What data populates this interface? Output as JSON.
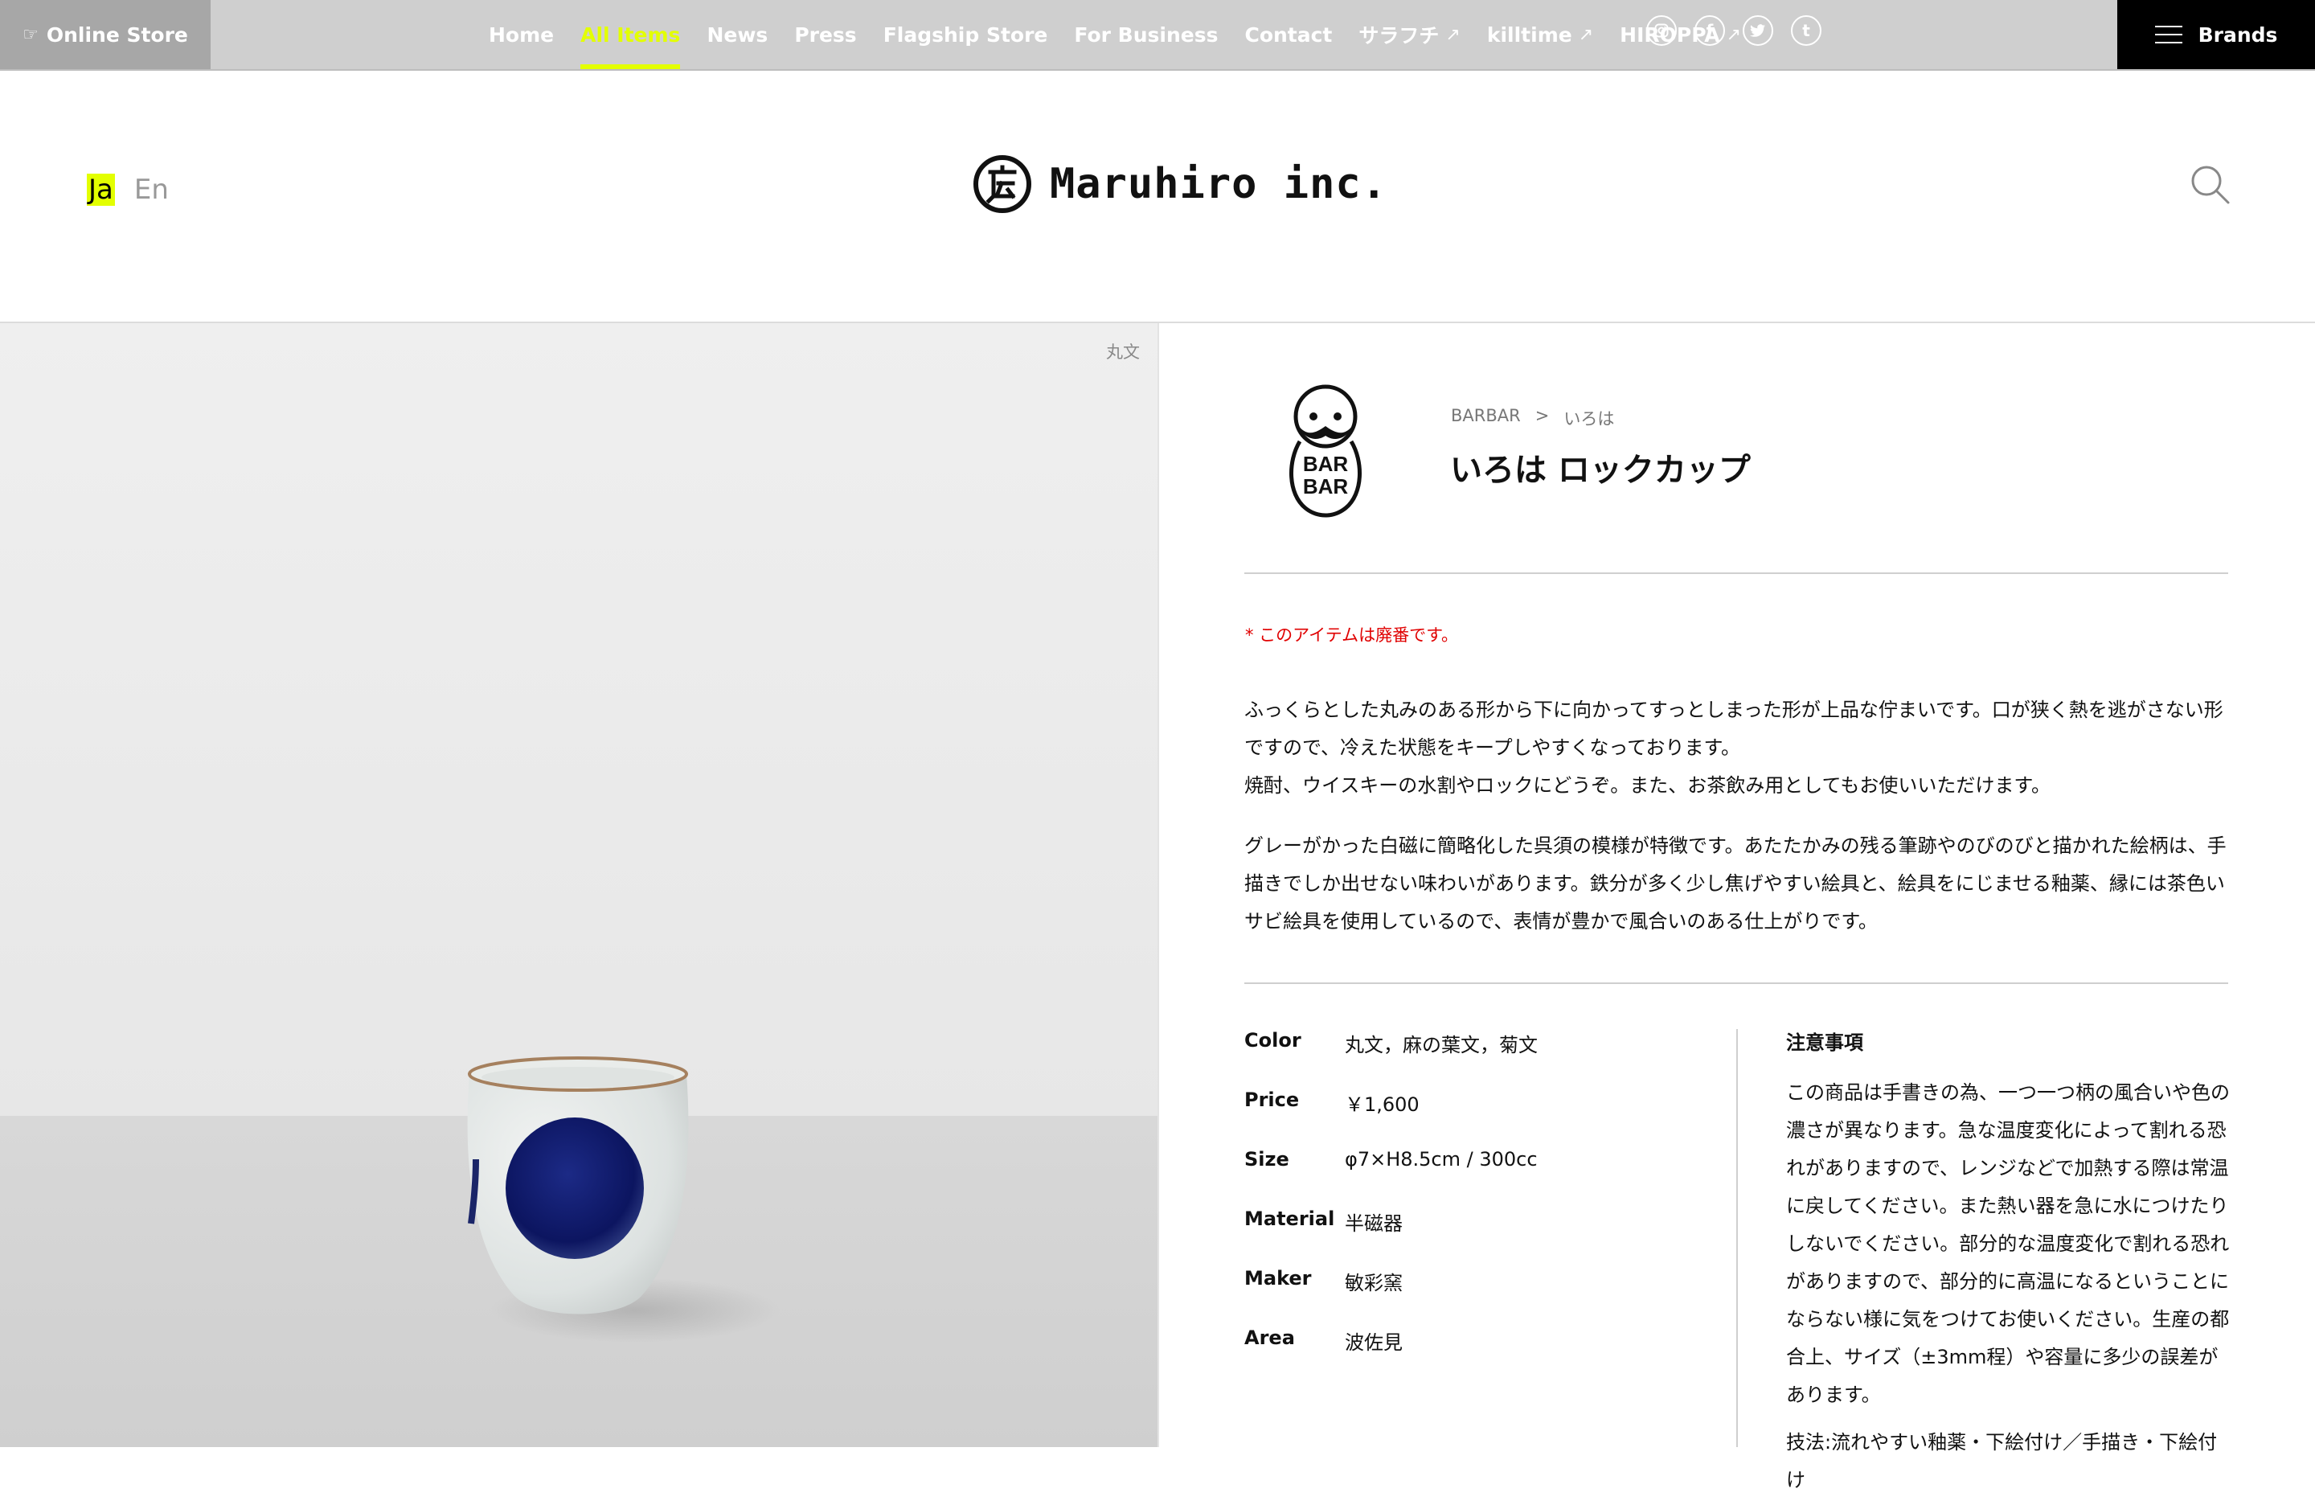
{
  "topbar": {
    "online_store": "Online Store",
    "nav": [
      {
        "label": "Home",
        "active": false
      },
      {
        "label": "All Items",
        "active": true
      },
      {
        "label": "News",
        "active": false
      },
      {
        "label": "Press",
        "active": false
      },
      {
        "label": "Flagship Store",
        "active": false
      },
      {
        "label": "For Business",
        "active": false
      },
      {
        "label": "Contact",
        "active": false
      },
      {
        "label": "サラフチ",
        "active": false
      },
      {
        "label": "killtime",
        "active": false
      },
      {
        "label": "HIROPPA",
        "active": false
      }
    ],
    "social_icons": [
      "instagram-icon",
      "facebook-icon",
      "twitter-icon",
      "tumblr-icon"
    ],
    "brands_label": "Brands",
    "accent_color": "#e3ff00"
  },
  "header": {
    "lang_ja": "Ja",
    "lang_en": "En",
    "logo_text": "Maruhiro inc."
  },
  "photo": {
    "caption": "丸文"
  },
  "product": {
    "breadcrumb": [
      "BARBAR",
      ">",
      "いろは"
    ],
    "title": "いろは ロックカップ",
    "notice": "* このアイテムは廃番です。",
    "description": [
      "ふっくらとした丸みのある形から下に向かってすっとしまった形が上品な佇まいです。口が狭く熱を逃がさない形ですので、冷えた状態をキープしやすくなっております。",
      "焼酎、ウイスキーの水割やロックにどうぞ。また、お茶飲み用としてもお使いいただけます。",
      "グレーがかった白磁に簡略化した呉須の模様が特徴です。あたたかみの残る筆跡やのびのびと描かれた絵柄は、手描きでしか出せない味わいがあります。鉄分が多く少し焦げやすい絵具と、絵具をにじませる釉薬、縁には茶色いサビ絵具を使用しているので、表情が豊かで風合いのある仕上がりです。"
    ],
    "specs": [
      {
        "key": "Color",
        "value": "丸文，麻の葉文，菊文"
      },
      {
        "key": "Price",
        "value": "￥1,600"
      },
      {
        "key": "Size",
        "value": "φ7×H8.5cm / 300cc"
      },
      {
        "key": "Material",
        "value": "半磁器"
      },
      {
        "key": "Maker",
        "value": "敏彩窯"
      },
      {
        "key": "Area",
        "value": "波佐見"
      }
    ],
    "caution_heading": "注意事項",
    "caution_text": [
      "この商品は手書きの為、一つ一つ柄の風合いや色の濃さが異なります。急な温度変化によって割れる恐れがありますので、レンジなどで加熱する際は常温に戻してください。また熱い器を急に水につけたりしないでください。部分的な温度変化で割れる恐れがありますので、部分的に高温になるということにならない様に気をつけてお使いください。生産の都合上、サイズ（±3mm程）や容量に多少の誤差があります。",
      "技法:流れやすい釉薬・下絵付け／手描き・下絵付け"
    ]
  }
}
